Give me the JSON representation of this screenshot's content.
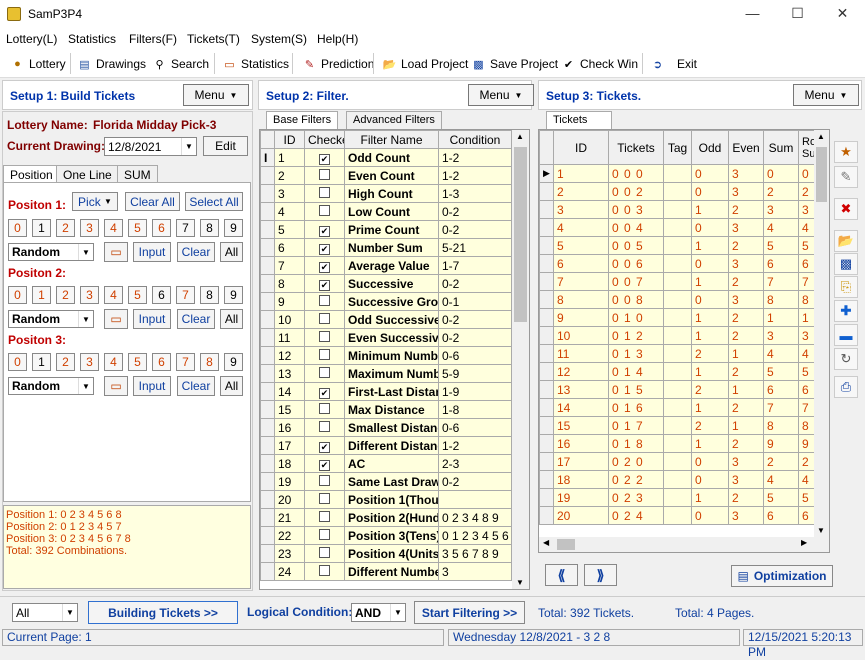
{
  "window": {
    "title": "SamP3P4"
  },
  "menu": [
    "Lottery(L)",
    "Statistics",
    "Filters(F)",
    "Tickets(T)",
    "System(S)",
    "Help(H)"
  ],
  "toolbar": {
    "lottery": "Lottery",
    "drawings": "Drawings",
    "search": "Search",
    "statistics": "Statistics",
    "prediction": "Prediction",
    "load": "Load Project",
    "save": "Save Project",
    "checkwin": "Check Win",
    "exit": "Exit"
  },
  "setup1": {
    "title": "Setup 1: Build  Tickets",
    "menu": "Menu",
    "lottery_label": "Lottery  Name:",
    "lottery_name": "Florida Midday Pick-3",
    "drawing_label": "Current Drawing:",
    "drawing_value": "12/8/2021",
    "edit": "Edit",
    "tabs": [
      "Position",
      "One Line",
      "SUM"
    ],
    "pick": "Pick",
    "clear_all": "Clear All",
    "select_all": "Select All",
    "positions": [
      {
        "label": "Positon 1:",
        "nums": [
          "0",
          "1",
          "2",
          "3",
          "4",
          "5",
          "6",
          "7",
          "8",
          "9"
        ],
        "selected": [
          false,
          true,
          false,
          false,
          false,
          false,
          false,
          true,
          true,
          true
        ],
        "mode": "Random"
      },
      {
        "label": "Positon 2:",
        "nums": [
          "0",
          "1",
          "2",
          "3",
          "4",
          "5",
          "6",
          "7",
          "8",
          "9"
        ],
        "selected": [
          false,
          false,
          false,
          false,
          false,
          false,
          true,
          false,
          true,
          true
        ],
        "mode": "Random"
      },
      {
        "label": "Positon 3:",
        "nums": [
          "0",
          "1",
          "2",
          "3",
          "4",
          "5",
          "6",
          "7",
          "8",
          "9"
        ],
        "selected": [
          false,
          true,
          false,
          false,
          false,
          false,
          false,
          false,
          false,
          true
        ],
        "mode": "Random"
      }
    ],
    "input": "Input",
    "clear": "Clear",
    "all": "All",
    "summary": [
      "Position 1:  0 2 3 4 5 6 8",
      "Position 2:  0 1 2 3 4 5 7",
      "Position 3:  0 2 3 4 5 6 7 8",
      "Total: 392 Combinations."
    ]
  },
  "setup2": {
    "title": "Setup 2: Filter.",
    "menu": "Menu",
    "tabs": [
      "Base Filters",
      "Advanced Filters"
    ],
    "columns": [
      "ID",
      "Checked",
      "Filter Name",
      "Condition"
    ],
    "rows": [
      [
        "1",
        true,
        "Odd Count",
        "1-2"
      ],
      [
        "2",
        false,
        "Even Count",
        "1-2"
      ],
      [
        "3",
        false,
        "High Count",
        "1-3"
      ],
      [
        "4",
        false,
        "Low Count",
        "0-2"
      ],
      [
        "5",
        true,
        "Prime Count",
        "0-2"
      ],
      [
        "6",
        true,
        "Number Sum",
        "5-21"
      ],
      [
        "7",
        true,
        "Average Value",
        "1-7"
      ],
      [
        "8",
        true,
        "Successive",
        "0-2"
      ],
      [
        "9",
        false,
        "Successive Gro",
        "0-1"
      ],
      [
        "10",
        false,
        "Odd Successive",
        "0-2"
      ],
      [
        "11",
        false,
        "Even Successiv",
        "0-2"
      ],
      [
        "12",
        false,
        "Minimum Numbe",
        "0-6"
      ],
      [
        "13",
        false,
        "Maximum Numbe",
        "5-9"
      ],
      [
        "14",
        true,
        "First-Last Distan",
        "1-9"
      ],
      [
        "15",
        false,
        "Max Distance",
        "1-8"
      ],
      [
        "16",
        false,
        "Smallest Distanc",
        "0-6"
      ],
      [
        "17",
        true,
        "Different Distanc",
        "1-2"
      ],
      [
        "18",
        true,
        "AC",
        "2-3"
      ],
      [
        "19",
        false,
        "Same Last Draw",
        "0-2"
      ],
      [
        "20",
        false,
        "Position 1(Thou:",
        ""
      ],
      [
        "21",
        false,
        "Position 2(Hund",
        "0 2 3 4 8 9"
      ],
      [
        "22",
        false,
        "Position 3(Tens)",
        "0 1 2 3 4 5 6"
      ],
      [
        "23",
        false,
        "Position 4(Units",
        "3 5 6 7 8 9"
      ],
      [
        "24",
        false,
        "Different Numbe",
        "3"
      ]
    ]
  },
  "setup3": {
    "title": "Setup 3: Tickets.",
    "menu": "Menu",
    "tab": "Tickets",
    "columns": [
      "ID",
      "Tickets",
      "Tag",
      "Odd",
      "Even",
      "Sum",
      "Root Sum"
    ],
    "rows": [
      [
        "1",
        "0 0 0",
        "",
        "0",
        "3",
        "0",
        "0"
      ],
      [
        "2",
        "0 0 2",
        "",
        "0",
        "3",
        "2",
        "2"
      ],
      [
        "3",
        "0 0 3",
        "",
        "1",
        "2",
        "3",
        "3"
      ],
      [
        "4",
        "0 0 4",
        "",
        "0",
        "3",
        "4",
        "4"
      ],
      [
        "5",
        "0 0 5",
        "",
        "1",
        "2",
        "5",
        "5"
      ],
      [
        "6",
        "0 0 6",
        "",
        "0",
        "3",
        "6",
        "6"
      ],
      [
        "7",
        "0 0 7",
        "",
        "1",
        "2",
        "7",
        "7"
      ],
      [
        "8",
        "0 0 8",
        "",
        "0",
        "3",
        "8",
        "8"
      ],
      [
        "9",
        "0 1 0",
        "",
        "1",
        "2",
        "1",
        "1"
      ],
      [
        "10",
        "0 1 2",
        "",
        "1",
        "2",
        "3",
        "3"
      ],
      [
        "11",
        "0 1 3",
        "",
        "2",
        "1",
        "4",
        "4"
      ],
      [
        "12",
        "0 1 4",
        "",
        "1",
        "2",
        "5",
        "5"
      ],
      [
        "13",
        "0 1 5",
        "",
        "2",
        "1",
        "6",
        "6"
      ],
      [
        "14",
        "0 1 6",
        "",
        "1",
        "2",
        "7",
        "7"
      ],
      [
        "15",
        "0 1 7",
        "",
        "2",
        "1",
        "8",
        "8"
      ],
      [
        "16",
        "0 1 8",
        "",
        "1",
        "2",
        "9",
        "9"
      ],
      [
        "17",
        "0 2 0",
        "",
        "0",
        "3",
        "2",
        "2"
      ],
      [
        "18",
        "0 2 2",
        "",
        "0",
        "3",
        "4",
        "4"
      ],
      [
        "19",
        "0 2 3",
        "",
        "1",
        "2",
        "5",
        "5"
      ],
      [
        "20",
        "0 2 4",
        "",
        "0",
        "3",
        "6",
        "6"
      ]
    ],
    "optimization": "Optimization"
  },
  "bottom": {
    "filter_select": "All",
    "building": "Building  Tickets >>",
    "logical_label": "Logical Condition:",
    "logical_value": "AND",
    "start_filtering": "Start Filtering  >>",
    "total_tickets": "Total: 392 Tickets.",
    "total_pages": "Total: 4 Pages."
  },
  "status": {
    "page": "Current Page: 1",
    "draw": "Wednesday 12/8/2021 - 3 2 8",
    "datetime": "12/15/2021 5:20:13 PM"
  }
}
